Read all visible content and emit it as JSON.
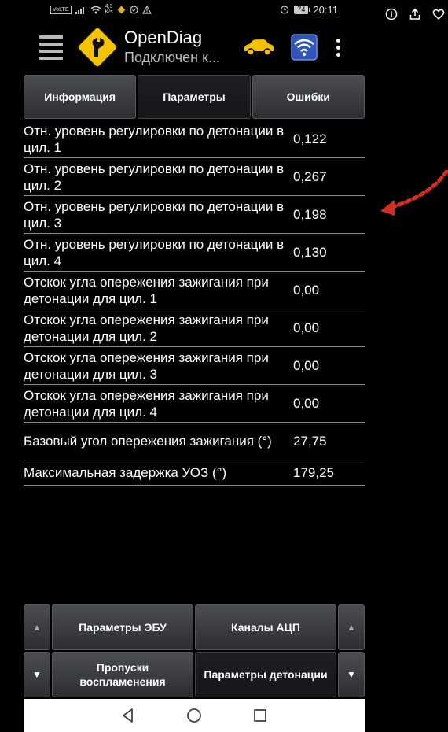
{
  "status_bar": {
    "volte": "VoLTE",
    "speed_value": "4,3",
    "speed_unit": "K/s",
    "battery": "74",
    "time": "20:11"
  },
  "app_bar": {
    "title": "OpenDiag",
    "subtitle": "Подключен к..."
  },
  "tabs": [
    {
      "label": "Информация",
      "active": false
    },
    {
      "label": "Параметры",
      "active": true
    },
    {
      "label": "Ошибки",
      "active": false
    }
  ],
  "parameters": [
    {
      "name": "Отн. уровень регулировки по детонации в цил. 1",
      "value": "0,122"
    },
    {
      "name": "Отн. уровень регулировки по детонации в цил. 2",
      "value": "0,267"
    },
    {
      "name": "Отн. уровень регулировки по детонации в цил. 3",
      "value": "0,198"
    },
    {
      "name": "Отн. уровень регулировки по детонации в цил. 4",
      "value": "0,130"
    },
    {
      "name": "Отскок угла опережения зажигания при детонации для цил. 1",
      "value": "0,00"
    },
    {
      "name": "Отскок угла опережения зажигания при детонации для цил. 2",
      "value": "0,00"
    },
    {
      "name": "Отскок угла опережения зажигания при детонации для цил. 3",
      "value": "0,00"
    },
    {
      "name": "Отскок угла опережения зажигания при детонации для цил. 4",
      "value": "0,00"
    },
    {
      "name": "Базовый угол опережения зажигания (°)",
      "value": "27,75"
    },
    {
      "name": "Максимальная задержка УОЗ (°)",
      "value": "179,25"
    }
  ],
  "bottom_buttons": {
    "row1": {
      "left": "Параметры ЭБУ",
      "right": "Каналы АЦП"
    },
    "row2": {
      "left": "Пропуски воспламенения",
      "right": "Параметры детонации"
    },
    "up": "▲",
    "down": "▼"
  },
  "colors": {
    "accent_arrow": "#d62d20",
    "logo_yellow": "#f5c400",
    "car_yellow": "#f2c200",
    "wifi_blue": "#2f56b8"
  }
}
